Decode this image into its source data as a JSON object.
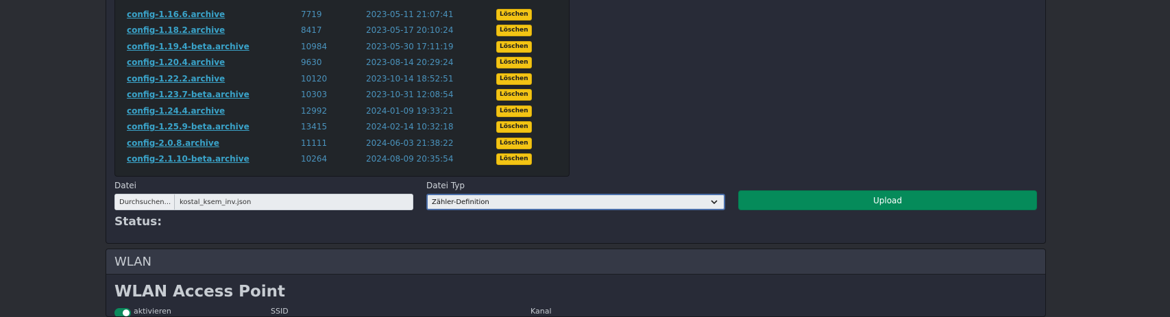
{
  "archives": {
    "delete_label": "Löschen",
    "rows": [
      {
        "name": "config-1.16.6.archive",
        "size": "7719",
        "date": "2023-05-11 21:07:41"
      },
      {
        "name": "config-1.18.2.archive",
        "size": "8417",
        "date": "2023-05-17 20:10:24"
      },
      {
        "name": "config-1.19.4-beta.archive",
        "size": "10984",
        "date": "2023-05-30 17:11:19"
      },
      {
        "name": "config-1.20.4.archive",
        "size": "9630",
        "date": "2023-08-14 20:29:24"
      },
      {
        "name": "config-1.22.2.archive",
        "size": "10120",
        "date": "2023-10-14 18:52:51"
      },
      {
        "name": "config-1.23.7-beta.archive",
        "size": "10303",
        "date": "2023-10-31 12:08:54"
      },
      {
        "name": "config-1.24.4.archive",
        "size": "12992",
        "date": "2024-01-09 19:33:21"
      },
      {
        "name": "config-1.25.9-beta.archive",
        "size": "13415",
        "date": "2024-02-14 10:32:18"
      },
      {
        "name": "config-2.0.8.archive",
        "size": "11111",
        "date": "2024-06-03 21:38:22"
      },
      {
        "name": "config-2.1.10-beta.archive",
        "size": "10264",
        "date": "2024-08-09 20:35:54"
      }
    ]
  },
  "upload": {
    "file_label": "Datei",
    "browse_label": "Durchsuchen...",
    "file_name": "kostal_ksem_inv.json",
    "type_label": "Datei Typ",
    "type_selected": "Zähler-Definition",
    "button_label": "Upload",
    "status_label": "Status:"
  },
  "wlan": {
    "header": "WLAN",
    "title": "WLAN Access Point",
    "enable_label": "aktivieren",
    "ssid_label": "SSID",
    "channel_label": "Kanal"
  },
  "colors": {
    "link": "#3aa3c9",
    "delete_button": "#f3c414",
    "upload_button": "#058b5a"
  }
}
